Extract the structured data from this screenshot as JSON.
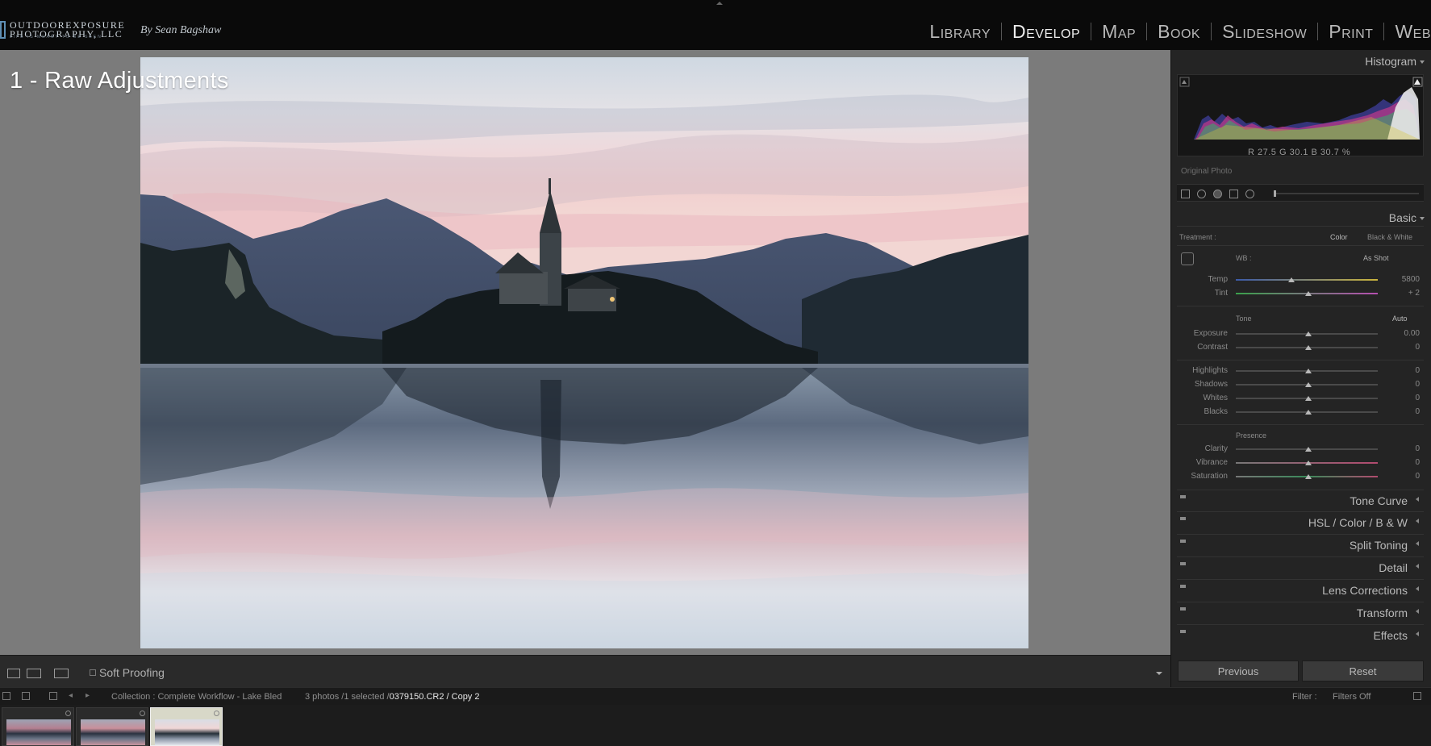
{
  "window": {
    "brand": "OUTDOOREXPOSURE PHOTOGRAPHY, LLC",
    "brand_tagline": "LIFE IS MEANT TO BE SEEN",
    "brand_by": "By Sean Bagshaw"
  },
  "modules": [
    {
      "label": "Library",
      "active": false
    },
    {
      "label": "Develop",
      "active": true
    },
    {
      "label": "Map",
      "active": false
    },
    {
      "label": "Book",
      "active": false
    },
    {
      "label": "Slideshow",
      "active": false
    },
    {
      "label": "Print",
      "active": false
    },
    {
      "label": "Web",
      "active": false
    }
  ],
  "canvas": {
    "overlay_title": "1 - Raw Adjustments"
  },
  "toolbar": {
    "soft_proofing_label": "Soft Proofing"
  },
  "right_panel": {
    "histogram": {
      "title": "Histogram",
      "readout": "R  27.5  G  30.1  B  30.7  %",
      "original_photo": "Original Photo"
    },
    "basic": {
      "title": "Basic",
      "treatment_label": "Treatment :",
      "treatment_color": "Color",
      "treatment_bw": "Black & White",
      "wb_label": "WB :",
      "wb_value": "As Shot",
      "temp": {
        "label": "Temp",
        "value": "5800"
      },
      "tint": {
        "label": "Tint",
        "value": "+ 2"
      },
      "tone_label": "Tone",
      "auto_label": "Auto",
      "exposure": {
        "label": "Exposure",
        "value": "0.00"
      },
      "contrast": {
        "label": "Contrast",
        "value": "0"
      },
      "highlights": {
        "label": "Highlights",
        "value": "0"
      },
      "shadows": {
        "label": "Shadows",
        "value": "0"
      },
      "whites": {
        "label": "Whites",
        "value": "0"
      },
      "blacks": {
        "label": "Blacks",
        "value": "0"
      },
      "presence_label": "Presence",
      "clarity": {
        "label": "Clarity",
        "value": "0"
      },
      "vibrance": {
        "label": "Vibrance",
        "value": "0"
      },
      "saturation": {
        "label": "Saturation",
        "value": "0"
      }
    },
    "collapsed_panels": [
      {
        "label": "Tone Curve"
      },
      {
        "label": "HSL  /  Color  /  B & W"
      },
      {
        "label": "Split Toning"
      },
      {
        "label": "Detail"
      },
      {
        "label": "Lens Corrections"
      },
      {
        "label": "Transform"
      },
      {
        "label": "Effects"
      }
    ],
    "previous_label": "Previous",
    "reset_label": "Reset"
  },
  "filmstrip_header": {
    "collection": "Collection : Complete Workflow - Lake Bled",
    "photos_count": "3 photos /1 selected /",
    "file_name": "0379150.CR2 / Copy 2",
    "filter_label": "Filter :",
    "filter_value": "Filters Off"
  },
  "filmstrip": {
    "thumbnail_count": 3,
    "selected_index": 2
  },
  "colors": {
    "accent_active_module": "#ececec",
    "panel_bg": "#242424",
    "canvas_bg": "#7b7b7b"
  }
}
